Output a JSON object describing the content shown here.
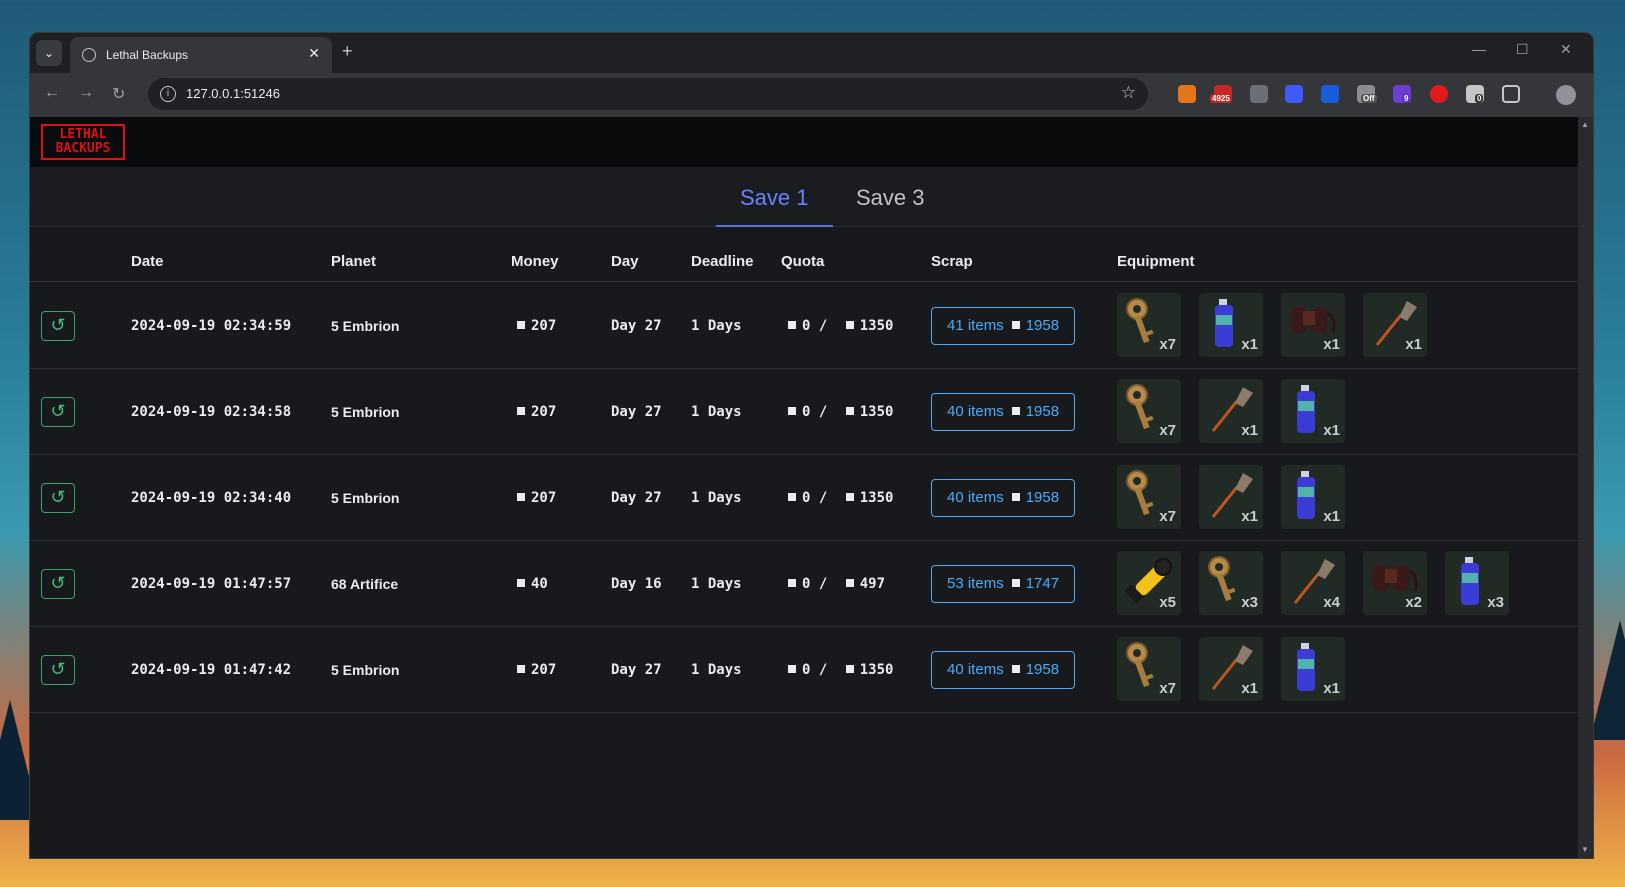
{
  "browser": {
    "tab_title": "Lethal Backups",
    "url": "127.0.0.1:51246",
    "extension_badges": [
      "4925",
      "Off",
      "9",
      "0"
    ]
  },
  "app": {
    "logo_text_top": "LETHAL",
    "logo_text_bottom": "BACKUPS",
    "save_tabs": [
      {
        "label": "Save 1",
        "active": true
      },
      {
        "label": "Save 3",
        "active": false
      }
    ],
    "columns": {
      "date": "Date",
      "planet": "Planet",
      "money": "Money",
      "day": "Day",
      "deadline": "Deadline",
      "quota": "Quota",
      "scrap": "Scrap",
      "equipment": "Equipment"
    },
    "rows": [
      {
        "date": "2024-09-19 02:34:59",
        "planet": "5 Embrion",
        "money": "207",
        "day": "Day 27",
        "deadline": "1 Days",
        "quota_current": "0",
        "quota_sep": "/",
        "quota_target": "1350",
        "scrap_items": "41 items",
        "scrap_value": "1958",
        "equipment": [
          {
            "icon": "key-icon",
            "qty": "x7"
          },
          {
            "icon": "spray-paint-icon",
            "qty": "x1"
          },
          {
            "icon": "jetpack-icon",
            "qty": "x1"
          },
          {
            "icon": "shovel-icon",
            "qty": "x1"
          }
        ]
      },
      {
        "date": "2024-09-19 02:34:58",
        "planet": "5 Embrion",
        "money": "207",
        "day": "Day 27",
        "deadline": "1 Days",
        "quota_current": "0",
        "quota_sep": "/",
        "quota_target": "1350",
        "scrap_items": "40 items",
        "scrap_value": "1958",
        "equipment": [
          {
            "icon": "key-icon",
            "qty": "x7"
          },
          {
            "icon": "shovel-icon",
            "qty": "x1"
          },
          {
            "icon": "spray-paint-icon",
            "qty": "x1"
          }
        ]
      },
      {
        "date": "2024-09-19 02:34:40",
        "planet": "5 Embrion",
        "money": "207",
        "day": "Day 27",
        "deadline": "1 Days",
        "quota_current": "0",
        "quota_sep": "/",
        "quota_target": "1350",
        "scrap_items": "40 items",
        "scrap_value": "1958",
        "equipment": [
          {
            "icon": "key-icon",
            "qty": "x7"
          },
          {
            "icon": "shovel-icon",
            "qty": "x1"
          },
          {
            "icon": "spray-paint-icon",
            "qty": "x1"
          }
        ]
      },
      {
        "date": "2024-09-19 01:47:57",
        "planet": "68 Artifice",
        "money": "40",
        "day": "Day 16",
        "deadline": "1 Days",
        "quota_current": "0",
        "quota_sep": "/",
        "quota_target": "497",
        "scrap_items": "53 items",
        "scrap_value": "1747",
        "equipment": [
          {
            "icon": "flashlight-icon",
            "qty": "x5"
          },
          {
            "icon": "key-icon",
            "qty": "x3"
          },
          {
            "icon": "shovel-icon",
            "qty": "x4"
          },
          {
            "icon": "jetpack-icon",
            "qty": "x2"
          },
          {
            "icon": "spray-paint-icon",
            "qty": "x3"
          }
        ]
      },
      {
        "date": "2024-09-19 01:47:42",
        "planet": "5 Embrion",
        "money": "207",
        "day": "Day 27",
        "deadline": "1 Days",
        "quota_current": "0",
        "quota_sep": "/",
        "quota_target": "1350",
        "scrap_items": "40 items",
        "scrap_value": "1958",
        "equipment": [
          {
            "icon": "key-icon",
            "qty": "x7"
          },
          {
            "icon": "shovel-icon",
            "qty": "x1"
          },
          {
            "icon": "spray-paint-icon",
            "qty": "x1"
          }
        ]
      }
    ]
  },
  "colors": {
    "accent_tab": "#6c80ff",
    "scrap_button": "#4dabf7",
    "restore_button": "#43c07c",
    "logo": "#dd1111"
  }
}
